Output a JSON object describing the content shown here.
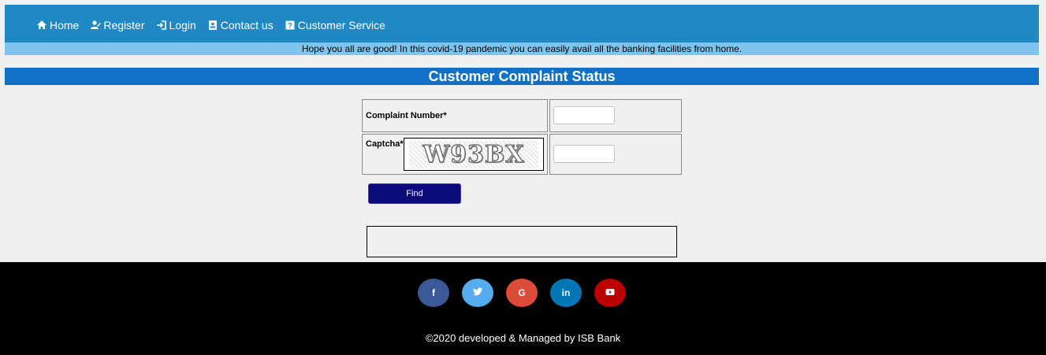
{
  "nav": {
    "items": [
      {
        "label": "Home",
        "icon": "home-icon"
      },
      {
        "label": "Register",
        "icon": "register-user-icon"
      },
      {
        "label": "Login",
        "icon": "login-icon"
      },
      {
        "label": "Contact us",
        "icon": "contact-card-icon"
      },
      {
        "label": "Customer Service",
        "icon": "help-icon"
      }
    ]
  },
  "notice": "Hope you all are good! In this covid-19 pandemic you can easily avail all the banking facilities from home.",
  "page_title": "Customer Complaint Status",
  "form": {
    "complaint_label": "Complaint Number*",
    "complaint_value": "",
    "captcha_label": "Captcha*",
    "captcha_text": "W93BX",
    "captcha_value": "",
    "find_label": "Find"
  },
  "footer": {
    "social": [
      {
        "name": "facebook",
        "glyph": "f",
        "color": "#3b5998"
      },
      {
        "name": "twitter",
        "glyph": "🐦",
        "color": "#55acee"
      },
      {
        "name": "google",
        "glyph": "G",
        "color": "#dd4b39"
      },
      {
        "name": "linkedin",
        "glyph": "in",
        "color": "#0077b5"
      },
      {
        "name": "youtube",
        "glyph": "▶",
        "color": "#bb0000"
      }
    ],
    "copyright": "©2020 developed & Managed by ISB Bank"
  }
}
